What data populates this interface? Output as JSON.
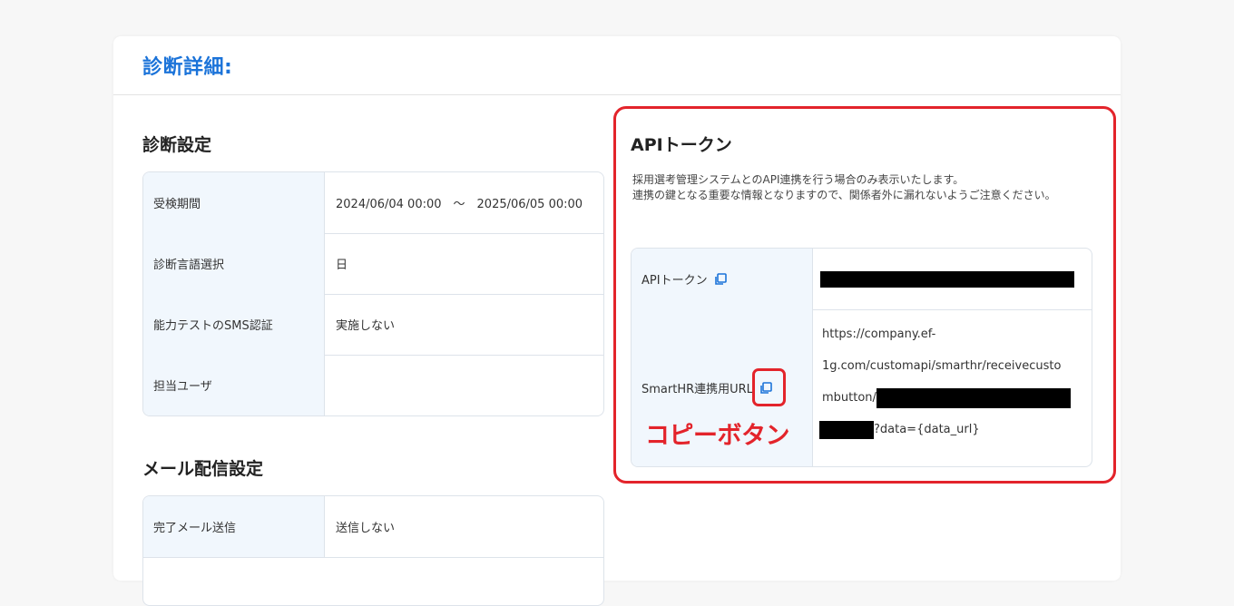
{
  "page": {
    "title": "診断詳細:"
  },
  "diagnosis_settings": {
    "title": "診断設定",
    "rows": [
      {
        "label": "受検期間",
        "value": "2024/06/04 00:00　～　2025/06/05 00:00"
      },
      {
        "label": "診断言語選択",
        "value": "日"
      },
      {
        "label": "能力テストのSMS認証",
        "value": "実施しない"
      },
      {
        "label": "担当ユーザ",
        "value": ""
      }
    ]
  },
  "mail_settings": {
    "title": "メール配信設定",
    "rows": [
      {
        "label": "完了メール送信",
        "value": "送信しない"
      }
    ]
  },
  "api_token": {
    "title": "APIトークン",
    "description_line1": "採用選考管理システムとのAPI連携を行う場合のみ表示いたします。",
    "description_line2": "連携の鍵となる重要な情報となりますので、関係者外に漏れないようご注意ください。",
    "token_label": "APIトークン",
    "url_label": "SmartHR連携用URL",
    "url_line1": "https://company.ef-",
    "url_line2": "1g.com/customapi/smarthr/receivecusto",
    "url_line3": "mbutton/",
    "url_line4": "?data={data_url}",
    "copy_icon": "copy-icon"
  },
  "annotation": {
    "label": "コピーボタン",
    "color": "#e3242b"
  },
  "colors": {
    "accent": "#1b73d9",
    "label_bg": "#f1f7fd",
    "border": "#dde3ea",
    "annotation": "#e3242b"
  }
}
